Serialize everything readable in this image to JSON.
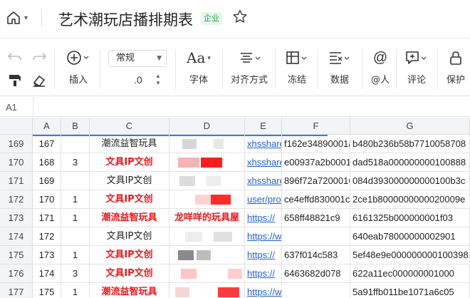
{
  "header": {
    "title": "艺术潮玩店播排期表",
    "badge": "企业"
  },
  "toolbar": {
    "format_select": "常规",
    "decimal_label": ".0",
    "insert": "插入",
    "font": "字体",
    "align": "对齐方式",
    "freeze": "冻结",
    "data": "数据",
    "mention": "@人",
    "comment": "评论",
    "protect": "保护"
  },
  "formula_bar": {
    "cell_ref": "A1"
  },
  "columns": [
    "A",
    "B",
    "C",
    "D",
    "E",
    "F",
    "G"
  ],
  "rows": [
    {
      "row": "169",
      "a": "167",
      "b": "",
      "c": "潮流益智玩具",
      "c_style": "black",
      "d": "",
      "e": "xhsshare",
      "f": "f162e34890001a",
      "g": "b480b236b58b7710058708"
    },
    {
      "row": "170",
      "a": "168",
      "b": "3",
      "c": "文具IP文创",
      "c_style": "red",
      "d": "",
      "e": "xhsshare",
      "f": "e00937a2b00015",
      "g": "dad518a000000000100888"
    },
    {
      "row": "171",
      "a": "169",
      "b": "",
      "c": "文具IP文创",
      "c_style": "black",
      "d": "",
      "e": "xhsshare",
      "f": "896f72a7200016",
      "g": "084d393000000000100b3c"
    },
    {
      "row": "172",
      "a": "170",
      "b": "1",
      "c": "文具IP文创",
      "c_style": "red",
      "d": "",
      "e": "user/profi",
      "f": "ce4effd830001c",
      "g": "2ce1b8000000000020009e"
    },
    {
      "row": "173",
      "a": "171",
      "b": "1",
      "c": "潮流益智玩具",
      "c_style": "red",
      "d": "龙咩咩的玩具屋",
      "e": "https://",
      "f": "658ff48821c9",
      "g": "6161325b000000001f03"
    },
    {
      "row": "174",
      "a": "172",
      "b": "",
      "c": "文具IP文创",
      "c_style": "black",
      "d": "",
      "e": "https://www.xiaohong",
      "f": "",
      "g": "640eab78000000002901"
    },
    {
      "row": "175",
      "a": "173",
      "b": "1",
      "c": "文具IP文创",
      "c_style": "red",
      "d": "",
      "e": "https://",
      "f": "637f014c583",
      "g": "5ef48e9e000000000100398"
    },
    {
      "row": "176",
      "a": "174",
      "b": "3",
      "c": "文具IP文创",
      "c_style": "red",
      "d": "",
      "e": "https://",
      "f": "6463682d078",
      "g": "622a11ec000000001000"
    },
    {
      "row": "177",
      "a": "175",
      "b": "1",
      "c": "潮流益智玩具",
      "c_style": "red",
      "d": "",
      "e": "https://www.xiaohong",
      "f": "",
      "g": "5a91ffb011be1071a6c05"
    }
  ]
}
